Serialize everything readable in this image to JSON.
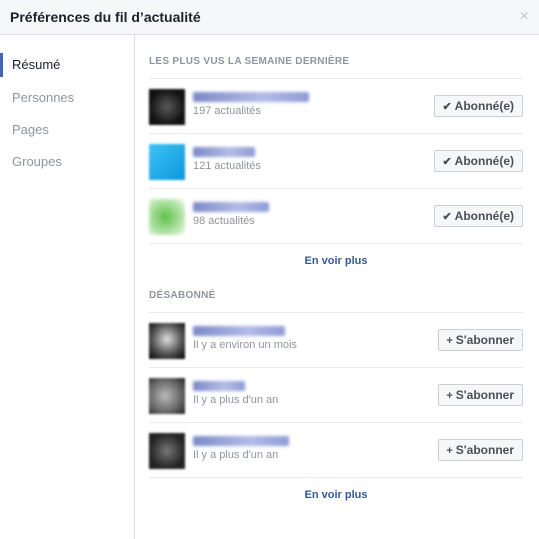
{
  "header": {
    "title": "Préférences du fil d’actualité",
    "close_glyph": "×"
  },
  "sidebar": {
    "items": [
      {
        "label": "Résumé",
        "active": true
      },
      {
        "label": "Personnes",
        "active": false
      },
      {
        "label": "Pages",
        "active": false
      },
      {
        "label": "Groupes",
        "active": false
      }
    ]
  },
  "most_viewed": {
    "title": "LES PLUS VUS LA SEMAINE DERNIÈRE",
    "rows": [
      {
        "name_redacted": "",
        "sub": "197 actualités",
        "button_label": "Abonné(e)",
        "button_icon": "checkmark-icon",
        "avatar_color": "#1b1b1b"
      },
      {
        "name_redacted": "",
        "sub": "121 actualités",
        "button_label": "Abonné(e)",
        "button_icon": "checkmark-icon",
        "avatar_color": "#18a8e6"
      },
      {
        "name_redacted": "",
        "sub": "98 actualités",
        "button_label": "Abonné(e)",
        "button_icon": "checkmark-icon",
        "avatar_color": "#63c14f"
      }
    ],
    "see_more": "En voir plus"
  },
  "unfollowed": {
    "title": "DÉSABONNÉ",
    "rows": [
      {
        "name_redacted": "",
        "sub": "Il y a environ un mois",
        "button_label": "S'abonner",
        "button_icon": "plus-icon",
        "avatar_color": "#555555"
      },
      {
        "name_redacted": "",
        "sub": "Il y a plus d'un an",
        "button_label": "S'abonner",
        "button_icon": "plus-icon",
        "avatar_color": "#8a8a8a"
      },
      {
        "name_redacted": "",
        "sub": "Il y a plus d'un an",
        "button_label": "S'abonner",
        "button_icon": "plus-icon",
        "avatar_color": "#3a3a3a"
      }
    ],
    "see_more": "En voir plus"
  },
  "colors": {
    "accent": "#4267b2",
    "link": "#365899",
    "muted": "#90949c"
  }
}
